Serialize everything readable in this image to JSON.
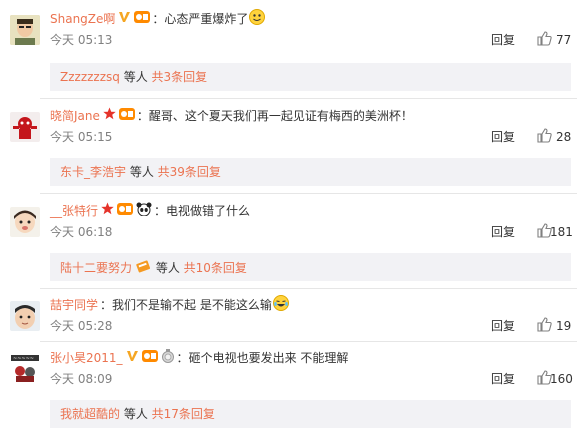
{
  "comments": [
    {
      "user": "ShangZe啊",
      "separator": "：",
      "text": "心态严重爆炸了",
      "time": "今天 05:13",
      "reply": "回复",
      "likes": "77",
      "sub": {
        "users": "Zzzzzzzsq",
        "mid": " 等人 ",
        "count": "共3条回复"
      }
    },
    {
      "user": "晓简Jane",
      "separator": "：",
      "text": "醒哥、这个夏天我们再一起见证有梅西的美洲杯！",
      "time": "今天 05:15",
      "reply": "回复",
      "likes": "28",
      "sub": {
        "users": "东卡_李浩宇",
        "mid": " 等人 ",
        "count": "共39条回复"
      }
    },
    {
      "user": "__张特行",
      "separator": "：",
      "text": "电视做错了什么",
      "time": "今天 06:18",
      "reply": "回复",
      "likes": "181",
      "sub": {
        "users": "陆十二要努力",
        "mid": " 等人 ",
        "count": "共10条回复"
      }
    },
    {
      "user": "喆宇同学",
      "separator": "：",
      "text": "我们不是输不起 是不能这么输",
      "time": "今天 05:28",
      "reply": "回复",
      "likes": "19"
    },
    {
      "user": "张小昊2011_",
      "separator": "：",
      "text": "砸个电视也要发出来 不能理解",
      "time": "今天 08:09",
      "reply": "回复",
      "likes": "160",
      "sub": {
        "users": "我就超酷的",
        "mid": " 等人 ",
        "count": "共17条回复"
      }
    }
  ],
  "colors": {
    "link": "#eb7350",
    "gold_v": "#f5a623",
    "red_star": "#e5332a",
    "subbox": "#f2f2f5"
  }
}
